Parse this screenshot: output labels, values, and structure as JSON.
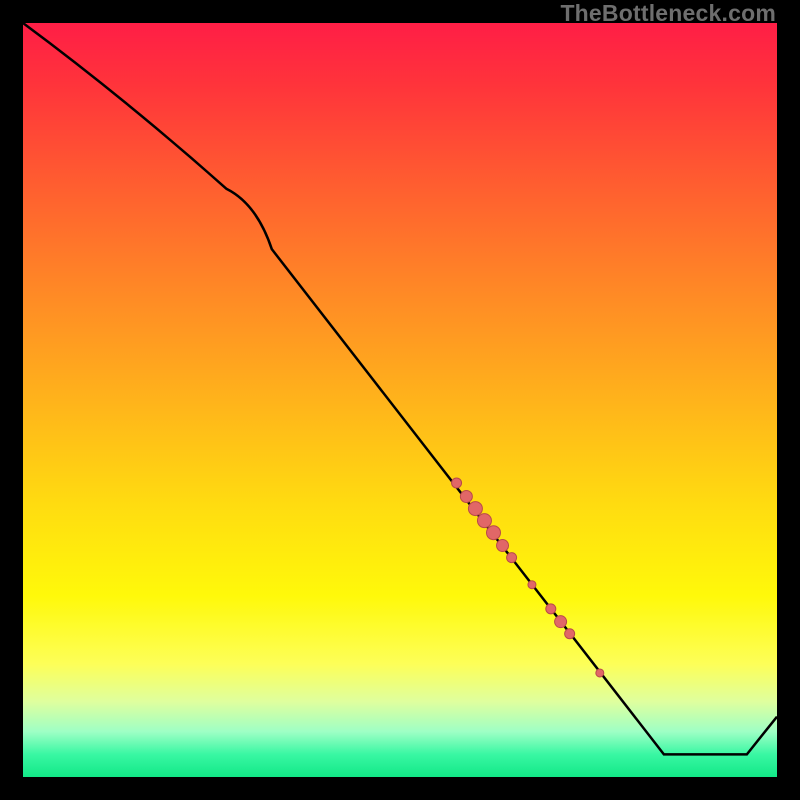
{
  "watermark": "TheBottleneck.com",
  "chart_data": {
    "type": "line",
    "title": "",
    "xlabel": "",
    "ylabel": "",
    "xlim": [
      0,
      100
    ],
    "ylim": [
      0,
      100
    ],
    "grid": false,
    "curve": [
      {
        "x": 0,
        "y": 100
      },
      {
        "x": 27,
        "y": 78
      },
      {
        "x": 33,
        "y": 70
      },
      {
        "x": 85,
        "y": 3
      },
      {
        "x": 96,
        "y": 3
      },
      {
        "x": 100,
        "y": 8
      }
    ],
    "markers": [
      {
        "x": 57.5,
        "y": 39.0,
        "r": 5
      },
      {
        "x": 58.8,
        "y": 37.2,
        "r": 6
      },
      {
        "x": 60.0,
        "y": 35.6,
        "r": 7
      },
      {
        "x": 61.2,
        "y": 34.0,
        "r": 7
      },
      {
        "x": 62.4,
        "y": 32.4,
        "r": 7
      },
      {
        "x": 63.6,
        "y": 30.7,
        "r": 6
      },
      {
        "x": 64.8,
        "y": 29.1,
        "r": 5
      },
      {
        "x": 67.5,
        "y": 25.5,
        "r": 4
      },
      {
        "x": 70.0,
        "y": 22.3,
        "r": 5
      },
      {
        "x": 71.3,
        "y": 20.6,
        "r": 6
      },
      {
        "x": 72.5,
        "y": 19.0,
        "r": 5
      },
      {
        "x": 76.5,
        "y": 13.8,
        "r": 4
      }
    ],
    "colors": {
      "curve": "#000000",
      "marker_fill": "#e16767",
      "marker_stroke": "#b94a4a",
      "gradient_top": "#ff1e46",
      "gradient_bottom": "#12e887"
    }
  }
}
